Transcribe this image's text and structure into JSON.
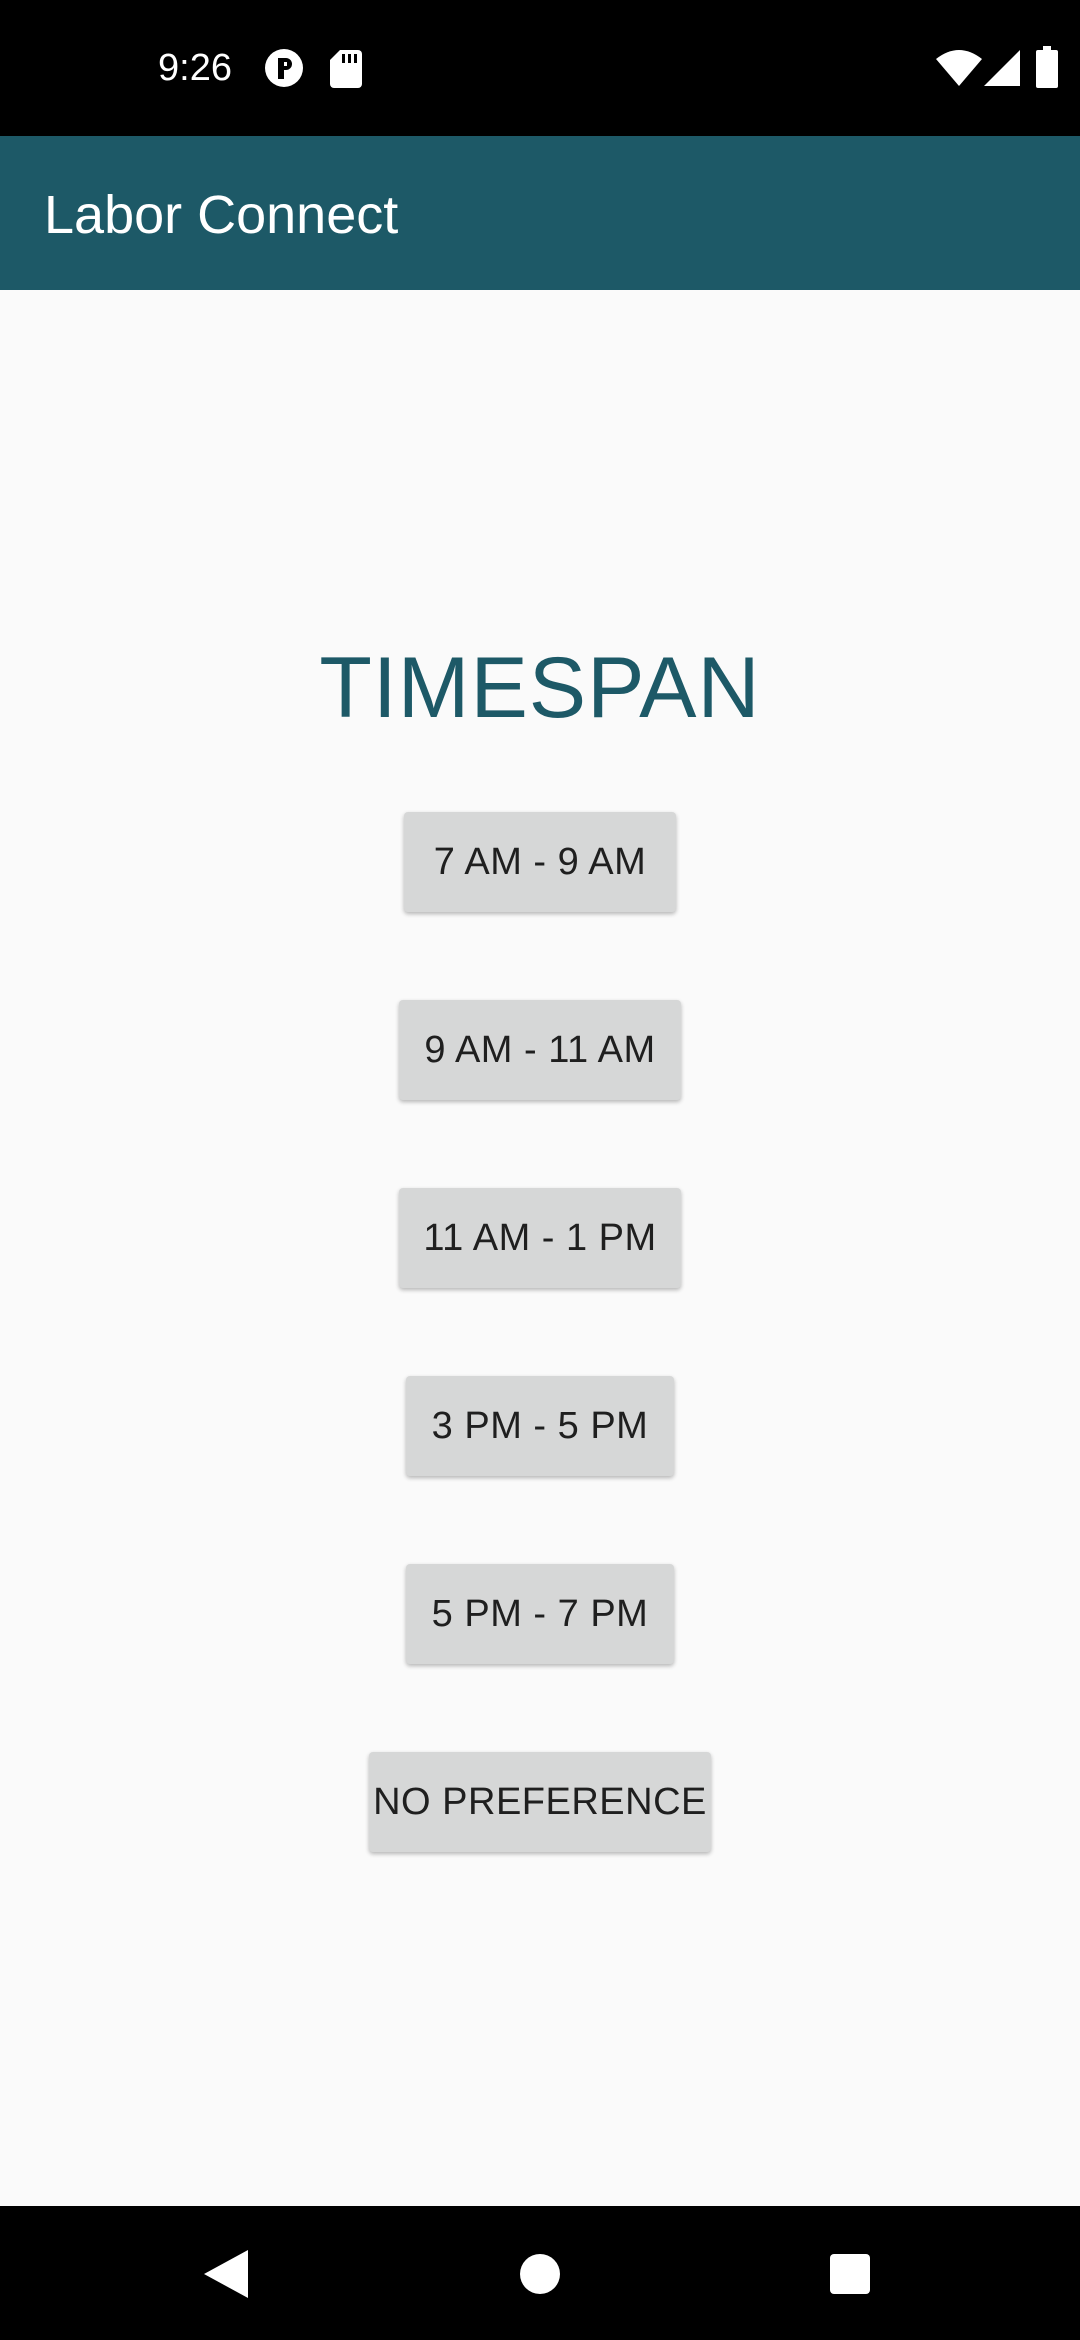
{
  "status_bar": {
    "time": "9:26",
    "icons": [
      "notification-app-icon",
      "sd-card-icon",
      "wifi-icon",
      "signal-icon",
      "battery-icon"
    ]
  },
  "app_bar": {
    "title": "Labor Connect",
    "color": "#1d5967"
  },
  "main": {
    "heading": "TIMESPAN",
    "heading_color": "#1d5967",
    "options": [
      {
        "label": "7 AM - 9 AM"
      },
      {
        "label": "9 AM - 11 AM"
      },
      {
        "label": "11 AM - 1 PM"
      },
      {
        "label": "3 PM - 5 PM"
      },
      {
        "label": "5 PM - 7 PM"
      },
      {
        "label": "NO PREFERENCE"
      }
    ]
  },
  "nav_bar": {
    "buttons": [
      "back-icon",
      "home-icon",
      "recents-icon"
    ]
  }
}
